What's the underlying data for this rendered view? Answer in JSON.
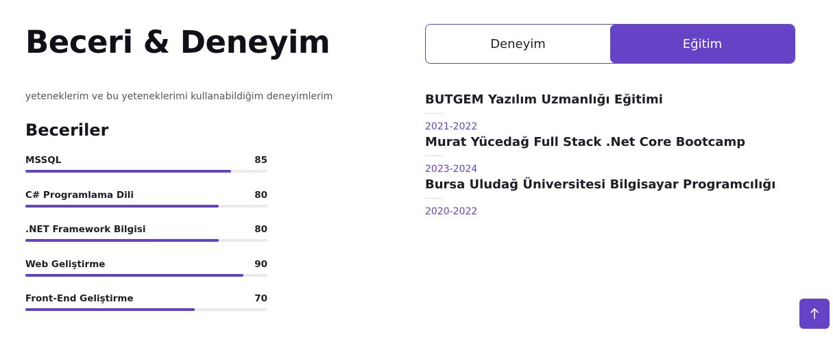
{
  "header": {
    "title": "Beceri & Deneyim",
    "subtitle": "yeteneklerim ve bu yeteneklerimi kullanabildiğim deneyimlerim"
  },
  "skills": {
    "heading": "Beceriler",
    "items": [
      {
        "label": "MSSQL",
        "value": "85",
        "percent": 85
      },
      {
        "label": "C# Programlama Dili",
        "value": "80",
        "percent": 80
      },
      {
        "label": ".NET Framework Bilgisi",
        "value": "80",
        "percent": 80
      },
      {
        "label": "Web Geliştirme",
        "value": "90",
        "percent": 90
      },
      {
        "label": "Front-End Geliştirme",
        "value": "70",
        "percent": 70
      }
    ]
  },
  "tabs": [
    {
      "label": "Deneyim",
      "active": false
    },
    {
      "label": "Eğitim",
      "active": true
    }
  ],
  "education": [
    {
      "title": "BUTGEM Yazılım Uzmanlığı Eğitimi",
      "date": "2021-2022"
    },
    {
      "title": "Murat Yücedağ Full Stack .Net Core Bootcamp",
      "date": "2023-2024"
    },
    {
      "title": "Bursa Uludağ Üniversitesi Bilgisayar Programcılığı",
      "date": "2020-2022"
    }
  ],
  "colors": {
    "accent": "#6543c6",
    "track": "#e9e9ee"
  },
  "scroll_top": {
    "icon": "arrow-up-icon"
  }
}
